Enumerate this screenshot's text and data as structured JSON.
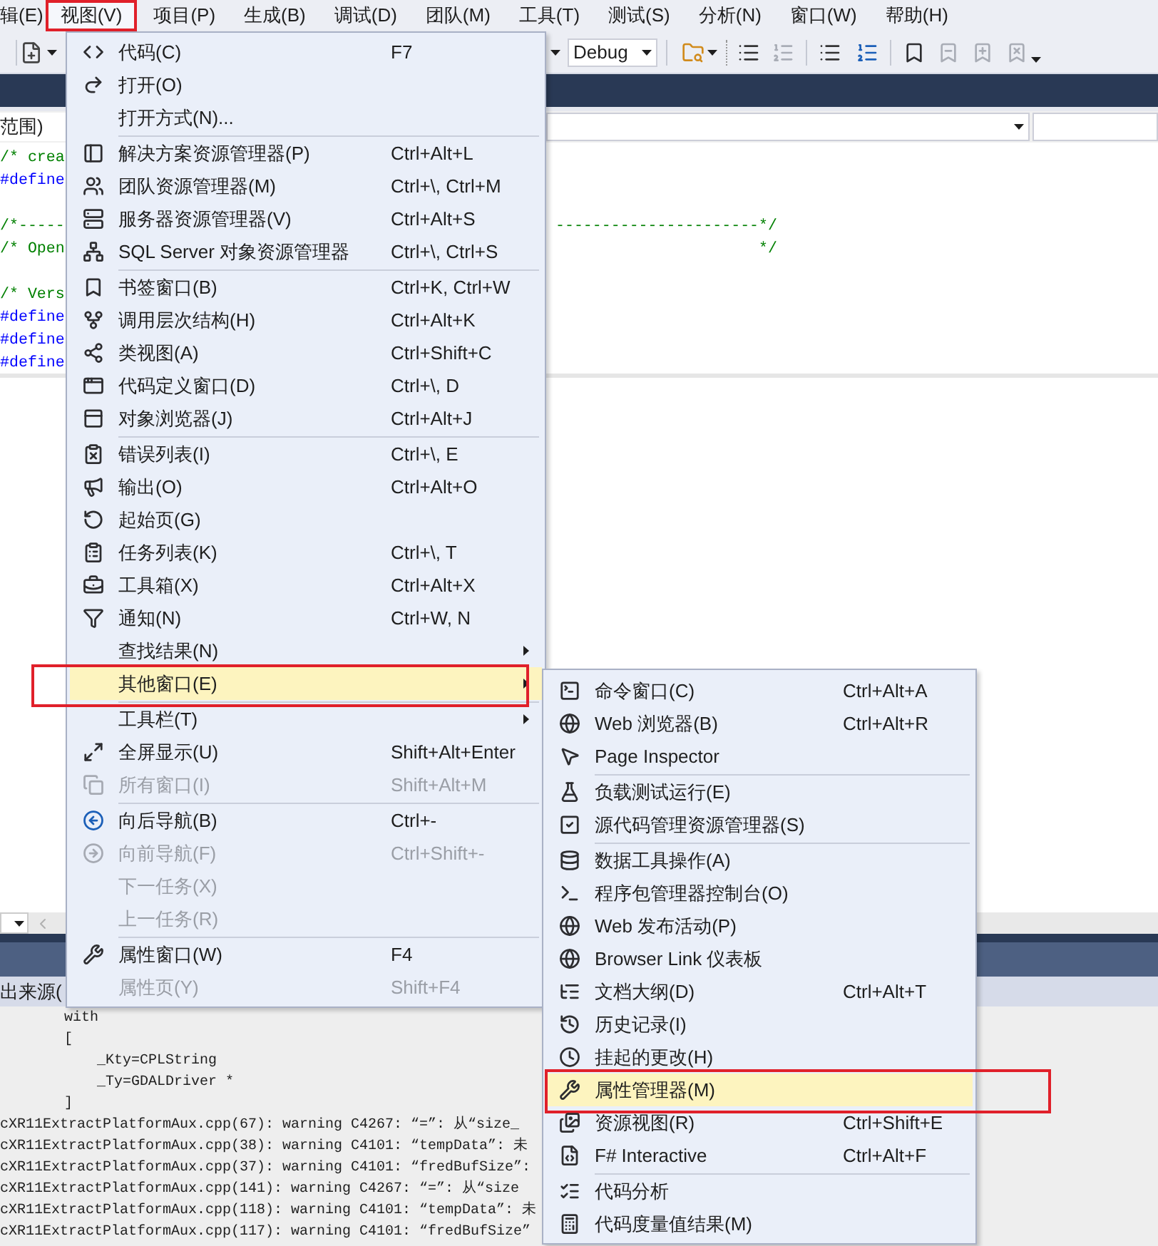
{
  "menu_bar": [
    {
      "label": "辑(E)",
      "selected": false
    },
    {
      "label": "视图(V)",
      "selected": true
    },
    {
      "label": "项目(P)",
      "selected": false
    },
    {
      "label": "生成(B)",
      "selected": false
    },
    {
      "label": "调试(D)",
      "selected": false
    },
    {
      "label": "团队(M)",
      "selected": false
    },
    {
      "label": "工具(T)",
      "selected": false
    },
    {
      "label": "测试(S)",
      "selected": false
    },
    {
      "label": "分析(N)",
      "selected": false
    },
    {
      "label": "窗口(W)",
      "selected": false
    },
    {
      "label": "帮助(H)",
      "selected": false
    }
  ],
  "toolbar": {
    "configuration": "Debug"
  },
  "scope_bar": {
    "scope": "范围)"
  },
  "editor": {
    "lines": [
      {
        "kind": "comment",
        "left": "/* crea"
      },
      {
        "kind": "directive",
        "left": "#define"
      },
      {
        "kind": "blank"
      },
      {
        "kind": "comment",
        "left": "/*-----",
        "right": "----------------------*/"
      },
      {
        "kind": "comment",
        "left": "/* Open",
        "right": "*/"
      },
      {
        "kind": "blank"
      },
      {
        "kind": "comment",
        "left": "/* Vers"
      },
      {
        "kind": "directive",
        "left": "#define"
      },
      {
        "kind": "directive",
        "left": "#define"
      },
      {
        "kind": "directive",
        "left": "#define"
      }
    ]
  },
  "output": {
    "source_label": "出来源(",
    "lines": [
      {
        "kind": "template",
        "text": "with"
      },
      {
        "kind": "template",
        "text": "["
      },
      {
        "kind": "param",
        "text": "_Kty=CPLString"
      },
      {
        "kind": "param",
        "text": "_Ty=GDALDriver *"
      },
      {
        "kind": "template",
        "text": "]"
      },
      {
        "kind": "message",
        "text": "cXR11ExtractPlatformAux.cpp(67): warning C4267: “=”: 从“size_"
      },
      {
        "kind": "message",
        "text": "cXR11ExtractPlatformAux.cpp(38): warning C4101: “tempData”: 未"
      },
      {
        "kind": "message",
        "text": "cXR11ExtractPlatformAux.cpp(37): warning C4101: “fredBufSize”:"
      },
      {
        "kind": "message",
        "text": "cXR11ExtractPlatformAux.cpp(141): warning C4267: “=”: 从“size"
      },
      {
        "kind": "message",
        "text": "cXR11ExtractPlatformAux.cpp(118): warning C4101: “tempData”: 未"
      },
      {
        "kind": "message",
        "text": "cXR11ExtractPlatformAux.cpp(117): warning C4101: “fredBufSize”"
      }
    ]
  },
  "view_menu": {
    "items": [
      {
        "kind": "item",
        "label": "代码(C)",
        "shortcut": "F7",
        "disabled": false,
        "selected": false
      },
      {
        "kind": "item",
        "label": "打开(O)",
        "disabled": false,
        "selected": false
      },
      {
        "kind": "item",
        "label": "打开方式(N)...",
        "disabled": false,
        "selected": false
      },
      {
        "kind": "separator"
      },
      {
        "kind": "item",
        "label": "解决方案资源管理器(P)",
        "shortcut": "Ctrl+Alt+L",
        "disabled": false,
        "selected": false
      },
      {
        "kind": "item",
        "label": "团队资源管理器(M)",
        "shortcut": "Ctrl+\\, Ctrl+M",
        "disabled": false,
        "selected": false
      },
      {
        "kind": "item",
        "label": "服务器资源管理器(V)",
        "shortcut": "Ctrl+Alt+S",
        "disabled": false,
        "selected": false
      },
      {
        "kind": "item",
        "label": "SQL Server 对象资源管理器",
        "shortcut": "Ctrl+\\, Ctrl+S",
        "disabled": false,
        "selected": false
      },
      {
        "kind": "separator"
      },
      {
        "kind": "item",
        "label": "书签窗口(B)",
        "shortcut": "Ctrl+K, Ctrl+W",
        "disabled": false,
        "selected": false
      },
      {
        "kind": "item",
        "label": "调用层次结构(H)",
        "shortcut": "Ctrl+Alt+K",
        "disabled": false,
        "selected": false
      },
      {
        "kind": "item",
        "label": "类视图(A)",
        "shortcut": "Ctrl+Shift+C",
        "disabled": false,
        "selected": false
      },
      {
        "kind": "item",
        "label": "代码定义窗口(D)",
        "shortcut": "Ctrl+\\, D",
        "disabled": false,
        "selected": false
      },
      {
        "kind": "item",
        "label": "对象浏览器(J)",
        "shortcut": "Ctrl+Alt+J",
        "disabled": false,
        "selected": false
      },
      {
        "kind": "separator"
      },
      {
        "kind": "item",
        "label": "错误列表(I)",
        "shortcut": "Ctrl+\\, E",
        "disabled": false,
        "selected": false
      },
      {
        "kind": "item",
        "label": "输出(O)",
        "shortcut": "Ctrl+Alt+O",
        "disabled": false,
        "selected": false
      },
      {
        "kind": "item",
        "label": "起始页(G)",
        "disabled": false,
        "selected": false
      },
      {
        "kind": "item",
        "label": "任务列表(K)",
        "shortcut": "Ctrl+\\, T",
        "disabled": false,
        "selected": false
      },
      {
        "kind": "item",
        "label": "工具箱(X)",
        "shortcut": "Ctrl+Alt+X",
        "disabled": false,
        "selected": false
      },
      {
        "kind": "item",
        "label": "通知(N)",
        "shortcut": "Ctrl+W, N",
        "disabled": false,
        "selected": false
      },
      {
        "kind": "submenu",
        "label": "查找结果(N)",
        "disabled": false,
        "selected": false
      },
      {
        "kind": "submenu",
        "label": "其他窗口(E)",
        "disabled": false,
        "selected": true
      },
      {
        "kind": "separator"
      },
      {
        "kind": "submenu",
        "label": "工具栏(T)",
        "disabled": false,
        "selected": false
      },
      {
        "kind": "item",
        "label": "全屏显示(U)",
        "shortcut": "Shift+Alt+Enter",
        "disabled": false,
        "selected": false
      },
      {
        "kind": "item",
        "label": "所有窗口(I)",
        "shortcut": "Shift+Alt+M",
        "disabled": true,
        "selected": false
      },
      {
        "kind": "separator"
      },
      {
        "kind": "item",
        "label": "向后导航(B)",
        "shortcut": "Ctrl+-",
        "disabled": false,
        "selected": false
      },
      {
        "kind": "item",
        "label": "向前导航(F)",
        "shortcut": "Ctrl+Shift+-",
        "disabled": true,
        "selected": false
      },
      {
        "kind": "item",
        "label": "下一任务(X)",
        "disabled": true,
        "selected": false
      },
      {
        "kind": "item",
        "label": "上一任务(R)",
        "disabled": true,
        "selected": false
      },
      {
        "kind": "separator"
      },
      {
        "kind": "item",
        "label": "属性窗口(W)",
        "shortcut": "F4",
        "disabled": false,
        "selected": false
      },
      {
        "kind": "item",
        "label": "属性页(Y)",
        "shortcut": "Shift+F4",
        "disabled": true,
        "selected": false
      }
    ]
  },
  "other_windows_menu": {
    "items": [
      {
        "kind": "item",
        "label": "命令窗口(C)",
        "shortcut": "Ctrl+Alt+A",
        "disabled": false,
        "selected": false
      },
      {
        "kind": "item",
        "label": "Web 浏览器(B)",
        "shortcut": "Ctrl+Alt+R",
        "disabled": false,
        "selected": false
      },
      {
        "kind": "item",
        "label": "Page Inspector",
        "disabled": false,
        "selected": false
      },
      {
        "kind": "separator"
      },
      {
        "kind": "item",
        "label": "负载测试运行(E)",
        "disabled": false,
        "selected": false
      },
      {
        "kind": "item",
        "label": "源代码管理资源管理器(S)",
        "disabled": false,
        "selected": false
      },
      {
        "kind": "separator"
      },
      {
        "kind": "item",
        "label": "数据工具操作(A)",
        "disabled": false,
        "selected": false
      },
      {
        "kind": "item",
        "label": "程序包管理器控制台(O)",
        "disabled": false,
        "selected": false
      },
      {
        "kind": "item",
        "label": "Web 发布活动(P)",
        "disabled": false,
        "selected": false
      },
      {
        "kind": "item",
        "label": "Browser Link 仪表板",
        "disabled": false,
        "selected": false
      },
      {
        "kind": "item",
        "label": "文档大纲(D)",
        "shortcut": "Ctrl+Alt+T",
        "disabled": false,
        "selected": false
      },
      {
        "kind": "item",
        "label": "历史记录(I)",
        "disabled": false,
        "selected": false
      },
      {
        "kind": "item",
        "label": "挂起的更改(H)",
        "disabled": false,
        "selected": false
      },
      {
        "kind": "item",
        "label": "属性管理器(M)",
        "disabled": false,
        "selected": true
      },
      {
        "kind": "item",
        "label": "资源视图(R)",
        "shortcut": "Ctrl+Shift+E",
        "disabled": false,
        "selected": false
      },
      {
        "kind": "item",
        "label": "F# Interactive",
        "shortcut": "Ctrl+Alt+F",
        "disabled": false,
        "selected": false
      },
      {
        "kind": "separator"
      },
      {
        "kind": "item",
        "label": "代码分析",
        "disabled": false,
        "selected": false
      },
      {
        "kind": "item",
        "label": "代码度量值结果(M)",
        "disabled": false,
        "selected": false
      }
    ]
  }
}
